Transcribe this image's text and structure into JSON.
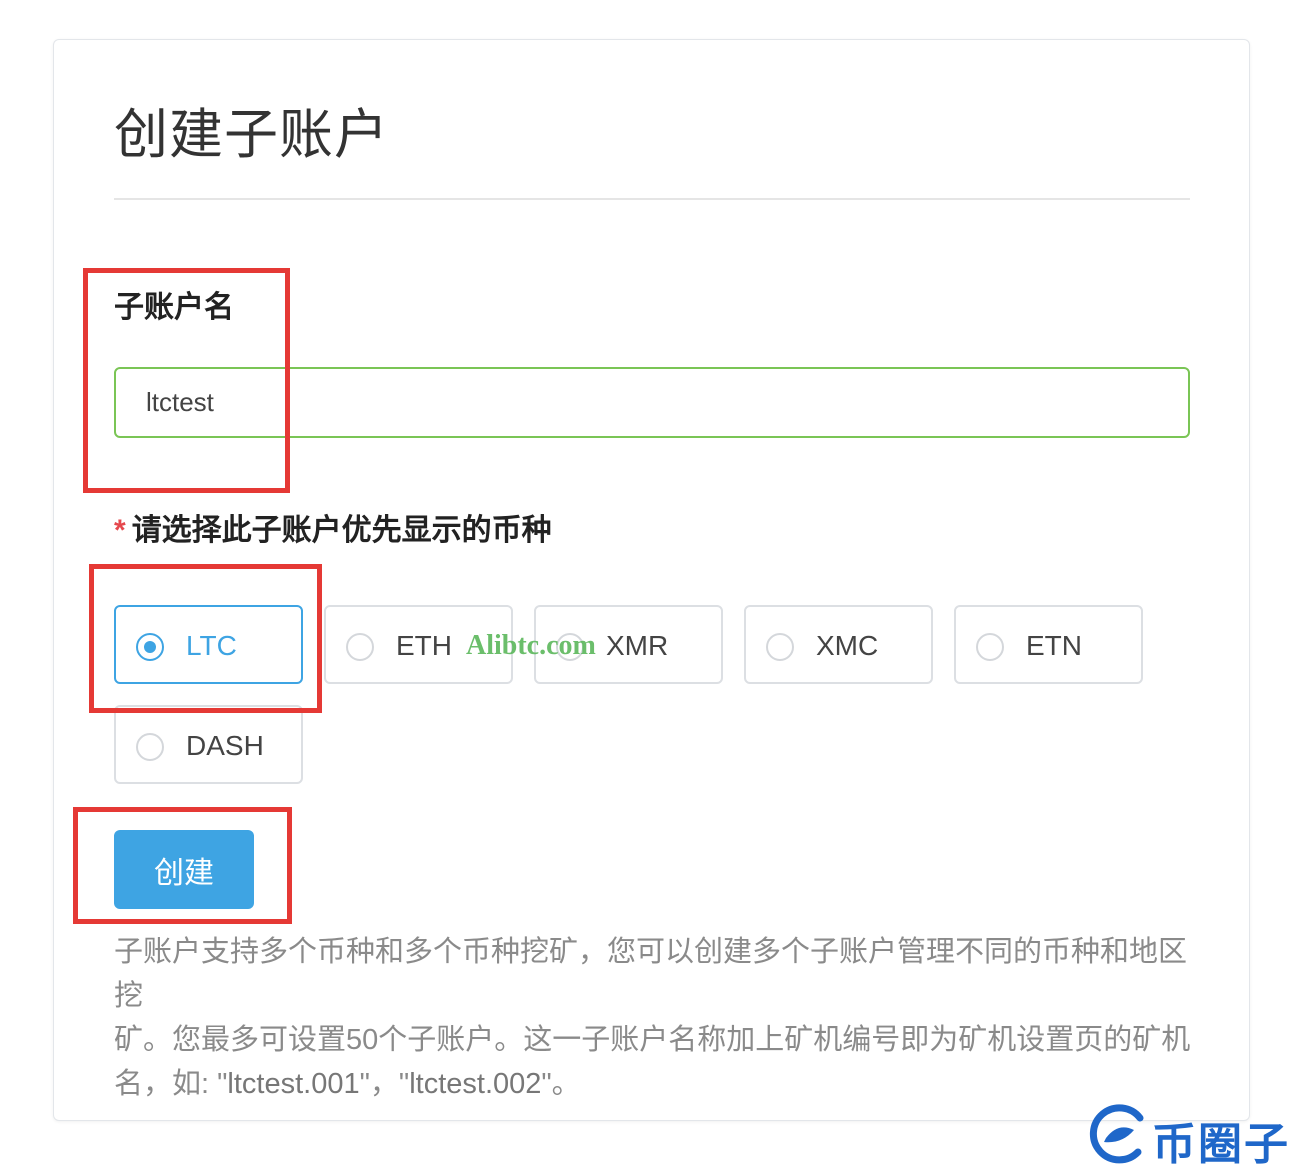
{
  "page": {
    "title": "创建子账户"
  },
  "form": {
    "name_label": "子账户名",
    "name_value": "ltctest",
    "required_mark": "*",
    "coin_label": "请选择此子账户优先显示的币种",
    "coins": [
      {
        "label": "LTC",
        "selected": true
      },
      {
        "label": "ETH",
        "selected": false
      },
      {
        "label": "XMR",
        "selected": false
      },
      {
        "label": "XMC",
        "selected": false
      },
      {
        "label": "ETN",
        "selected": false
      },
      {
        "label": "DASH",
        "selected": false
      }
    ],
    "submit_label": "创建"
  },
  "help": {
    "line1": "子账户支持多个币种和多个币种挖矿，您可以创建多个子账户管理不同的币种和地区挖",
    "line2": "矿。您最多可设置50个子账户。这一子账户名称加上矿机编号即为矿机设置页的矿机",
    "line3_prefix": "名，如: \"",
    "example1": "ltctest.001",
    "line3_mid": "\"，\"",
    "example2": "ltctest.002",
    "line3_suffix": "\"。"
  },
  "watermark": "Alibtc.com",
  "corner_logo": {
    "text": "币圈子",
    "icon": "logo-e-icon"
  },
  "colors": {
    "accent": "#3ea4e3",
    "input_border": "#7ac555",
    "highlight": "#e53935",
    "watermark": "#5cb85c",
    "logo": "#1f67c9"
  }
}
